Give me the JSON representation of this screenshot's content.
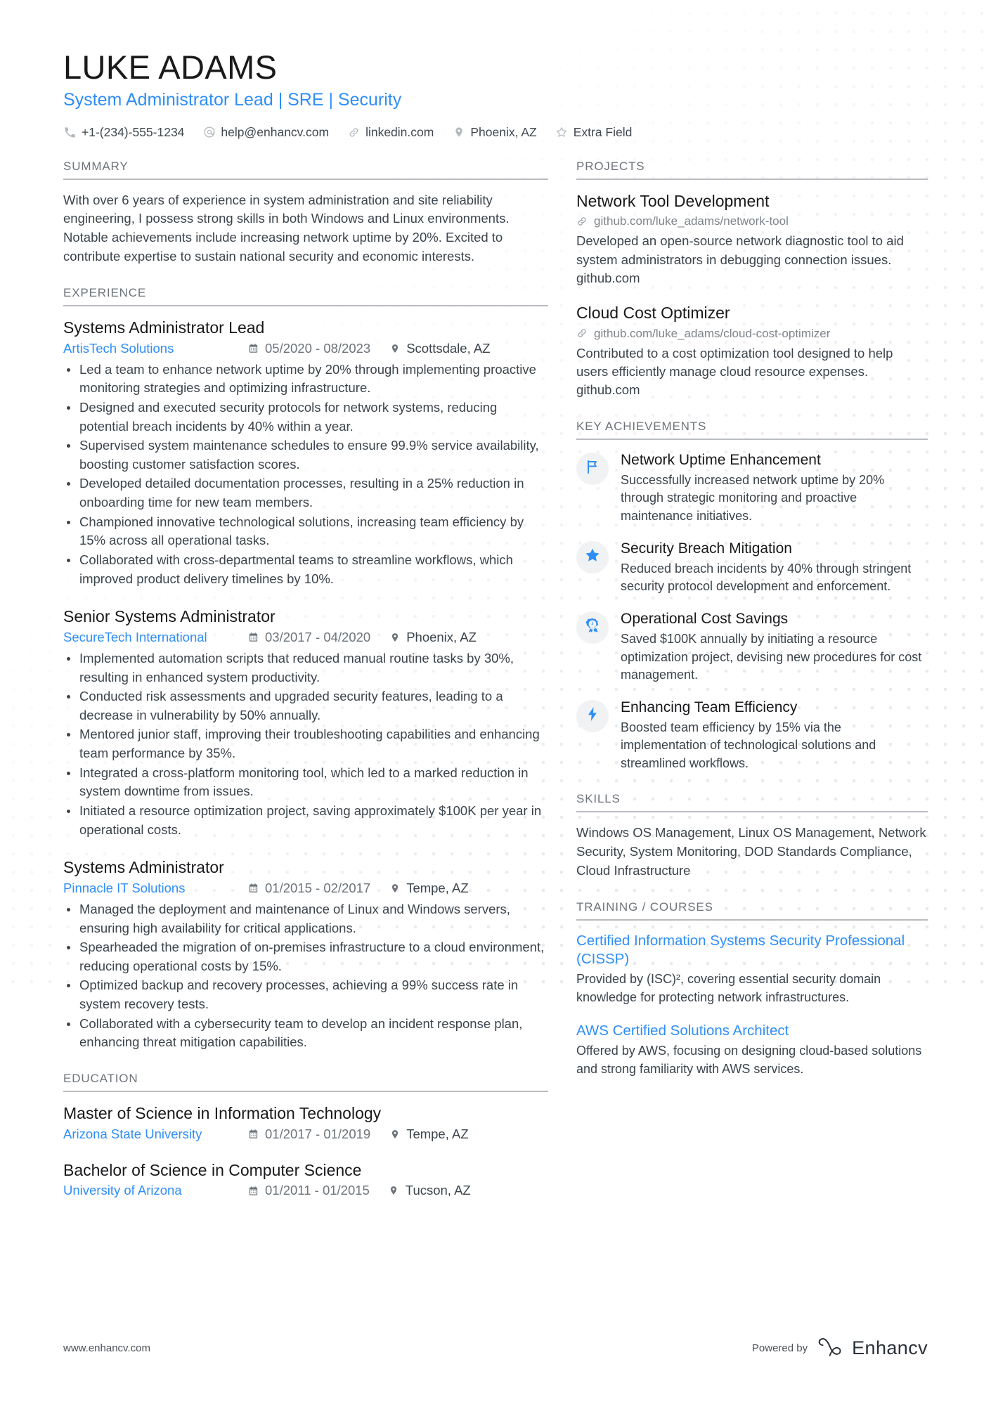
{
  "header": {
    "name": "LUKE ADAMS",
    "headline": "System Administrator Lead | SRE | Security",
    "contacts": [
      {
        "icon": "phone-icon",
        "text": "+1-(234)-555-1234"
      },
      {
        "icon": "email-icon",
        "text": "help@enhancv.com"
      },
      {
        "icon": "link-icon",
        "text": "linkedin.com"
      },
      {
        "icon": "location-icon",
        "text": "Phoenix, AZ"
      },
      {
        "icon": "star-icon",
        "text": "Extra Field"
      }
    ]
  },
  "sections": {
    "summary_title": "SUMMARY",
    "experience_title": "EXPERIENCE",
    "education_title": "EDUCATION",
    "projects_title": "PROJECTS",
    "achievements_title": "KEY ACHIEVEMENTS",
    "skills_title": "SKILLS",
    "training_title": "TRAINING / COURSES"
  },
  "summary": {
    "text": "With over 6 years of experience in system administration and site reliability engineering, I possess strong skills in both Windows and Linux environments. Notable achievements include increasing network uptime by 20%. Excited to contribute expertise to sustain national security and economic interests."
  },
  "experience": [
    {
      "title": "Systems Administrator Lead",
      "org": "ArtisTech Solutions",
      "dates": "05/2020 - 08/2023",
      "location": "Scottsdale, AZ",
      "bullets": [
        "Led a team to enhance network uptime by 20% through implementing proactive monitoring strategies and optimizing infrastructure.",
        "Designed and executed security protocols for network systems, reducing potential breach incidents by 40% within a year.",
        "Supervised system maintenance schedules to ensure 99.9% service availability, boosting customer satisfaction scores.",
        "Developed detailed documentation processes, resulting in a 25% reduction in onboarding time for new team members.",
        "Championed innovative technological solutions, increasing team efficiency by 15% across all operational tasks.",
        "Collaborated with cross-departmental teams to streamline workflows, which improved product delivery timelines by 10%."
      ]
    },
    {
      "title": "Senior Systems Administrator",
      "org": "SecureTech International",
      "dates": "03/2017 - 04/2020",
      "location": "Phoenix, AZ",
      "bullets": [
        "Implemented automation scripts that reduced manual routine tasks by 30%, resulting in enhanced system productivity.",
        "Conducted risk assessments and upgraded security features, leading to a decrease in vulnerability by 50% annually.",
        "Mentored junior staff, improving their troubleshooting capabilities and enhancing team performance by 35%.",
        "Integrated a cross-platform monitoring tool, which led to a marked reduction in system downtime from issues.",
        "Initiated a resource optimization project, saving approximately $100K per year in operational costs."
      ]
    },
    {
      "title": "Systems Administrator",
      "org": "Pinnacle IT Solutions",
      "dates": "01/2015 - 02/2017",
      "location": "Tempe, AZ",
      "bullets": [
        "Managed the deployment and maintenance of Linux and Windows servers, ensuring high availability for critical applications.",
        "Spearheaded the migration of on-premises infrastructure to a cloud environment, reducing operational costs by 15%.",
        "Optimized backup and recovery processes, achieving a 99% success rate in system recovery tests.",
        "Collaborated with a cybersecurity team to develop an incident response plan, enhancing threat mitigation capabilities."
      ]
    }
  ],
  "education": [
    {
      "title": "Master of Science in Information Technology",
      "org": "Arizona State University",
      "dates": "01/2017 - 01/2019",
      "location": "Tempe, AZ"
    },
    {
      "title": "Bachelor of Science in Computer Science",
      "org": "University of Arizona",
      "dates": "01/2011 - 01/2015",
      "location": "Tucson, AZ"
    }
  ],
  "projects": [
    {
      "title": "Network Tool Development",
      "link": "github.com/luke_adams/network-tool",
      "description": "Developed an open-source network diagnostic tool to aid system administrators in debugging connection issues. github.com"
    },
    {
      "title": "Cloud Cost Optimizer",
      "link": "github.com/luke_adams/cloud-cost-optimizer",
      "description": "Contributed to a cost optimization tool designed to help users efficiently manage cloud resource expenses. github.com"
    }
  ],
  "achievements": [
    {
      "icon": "flag-icon",
      "title": "Network Uptime Enhancement",
      "description": "Successfully increased network uptime by 20% through strategic monitoring and proactive maintenance initiatives."
    },
    {
      "icon": "star-badge-icon",
      "title": "Security Breach Mitigation",
      "description": "Reduced breach incidents by 40% through stringent security protocol development and enforcement."
    },
    {
      "icon": "award-icon",
      "title": "Operational Cost Savings",
      "description": "Saved $100K annually by initiating a resource optimization project, devising new procedures for cost management."
    },
    {
      "icon": "bolt-icon",
      "title": "Enhancing Team Efficiency",
      "description": "Boosted team efficiency by 15% via the implementation of technological solutions and streamlined workflows."
    }
  ],
  "skills": {
    "text": "Windows OS Management, Linux OS Management, Network Security, System Monitoring, DOD Standards Compliance, Cloud Infrastructure"
  },
  "training": [
    {
      "title": "Certified Information Systems Security Professional (CISSP)",
      "description": "Provided by (ISC)², covering essential security domain knowledge for protecting network infrastructures."
    },
    {
      "title": "AWS Certified Solutions Architect",
      "description": "Offered by AWS, focusing on designing cloud-based solutions and strong familiarity with AWS services."
    }
  ],
  "footer": {
    "url": "www.enhancv.com",
    "powered_by": "Powered by",
    "brand": "Enhancv"
  },
  "colors": {
    "accent": "#2f8ef7",
    "heading": "#6d747b",
    "body": "#3c444c",
    "rule": "#b9bcc0"
  }
}
